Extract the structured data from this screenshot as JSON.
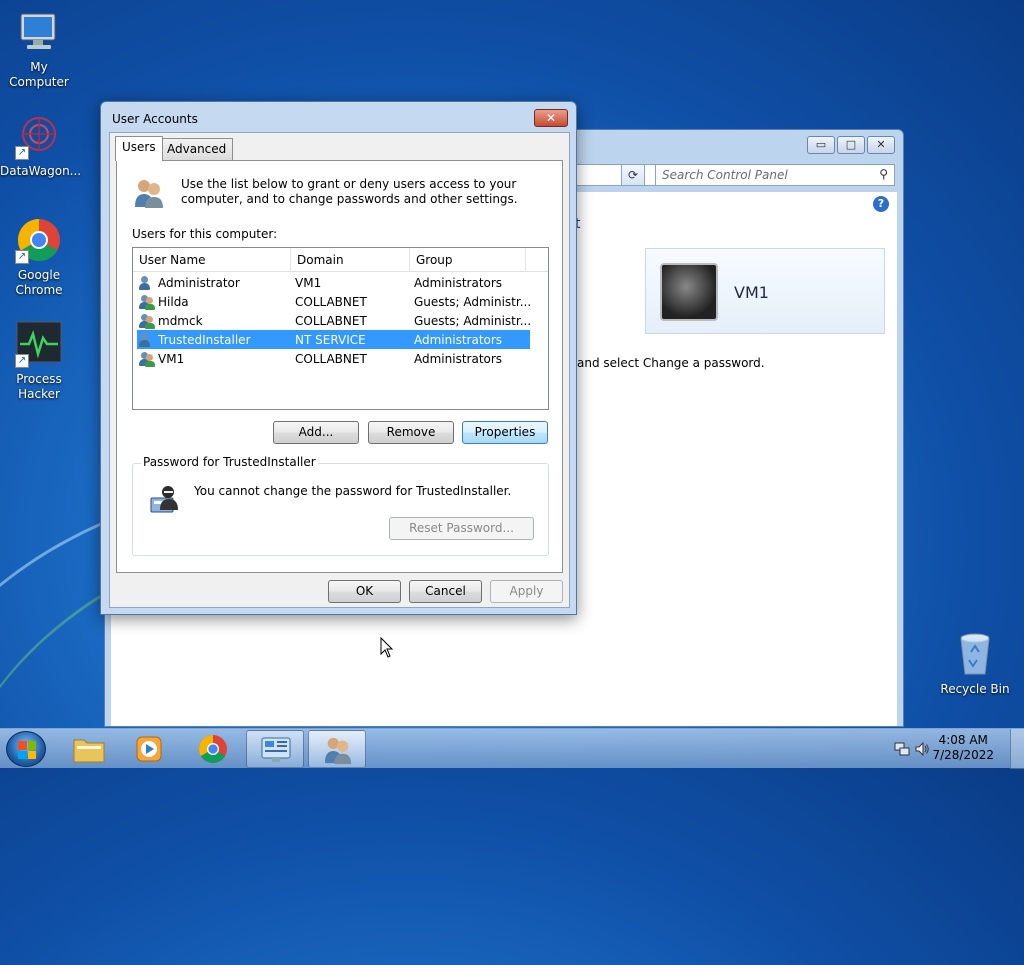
{
  "desktop": {
    "icons": [
      {
        "label": "My Computer",
        "icon": "computer-icon"
      },
      {
        "label": "DataWagon...",
        "icon": "datawagon-icon"
      },
      {
        "label": "Google Chrome",
        "icon": "chrome-icon"
      },
      {
        "label": "Process Hacker",
        "icon": "process-hacker-icon"
      },
      {
        "label": "Recycle Bin",
        "icon": "recycle-bin-icon"
      }
    ]
  },
  "control_panel": {
    "search_placeholder": "Search Control Panel",
    "heading_fragment": "t",
    "user_name": "VM1",
    "instruction_fragment": "and select Change a password.",
    "buttons": {
      "minimize": "▭",
      "maximize": "□",
      "close": "✕"
    }
  },
  "dialog": {
    "title": "User Accounts",
    "close": "✕",
    "tabs": [
      {
        "label": "Users",
        "active": true
      },
      {
        "label": "Advanced",
        "active": false
      }
    ],
    "intro": "Use the list below to grant or deny users access to your computer, and to change passwords and other settings.",
    "users_label": "Users for this computer:",
    "columns": [
      "User Name",
      "Domain",
      "Group"
    ],
    "users": [
      {
        "name": "Administrator",
        "domain": "VM1",
        "group": "Administrators",
        "selected": false
      },
      {
        "name": "Hilda",
        "domain": "COLLABNET",
        "group": "Guests; Administr...",
        "selected": false
      },
      {
        "name": "mdmck",
        "domain": "COLLABNET",
        "group": "Guests; Administr...",
        "selected": false
      },
      {
        "name": "TrustedInstaller",
        "domain": "NT SERVICE",
        "group": "Administrators",
        "selected": true
      },
      {
        "name": "VM1",
        "domain": "COLLABNET",
        "group": "Administrators",
        "selected": false
      }
    ],
    "add_button": "Add...",
    "remove_button": "Remove",
    "properties_button": "Properties",
    "password_group_label": "Password for TrustedInstaller",
    "password_message": "You cannot change the password for TrustedInstaller.",
    "reset_password_button": "Reset Password...",
    "ok_button": "OK",
    "cancel_button": "Cancel",
    "apply_button": "Apply"
  },
  "taskbar": {
    "clock_time": "4:08 AM",
    "clock_date": "7/28/2022",
    "items": [
      "start-button",
      "explorer",
      "media-player",
      "chrome",
      "control-panel",
      "user-accounts"
    ]
  }
}
